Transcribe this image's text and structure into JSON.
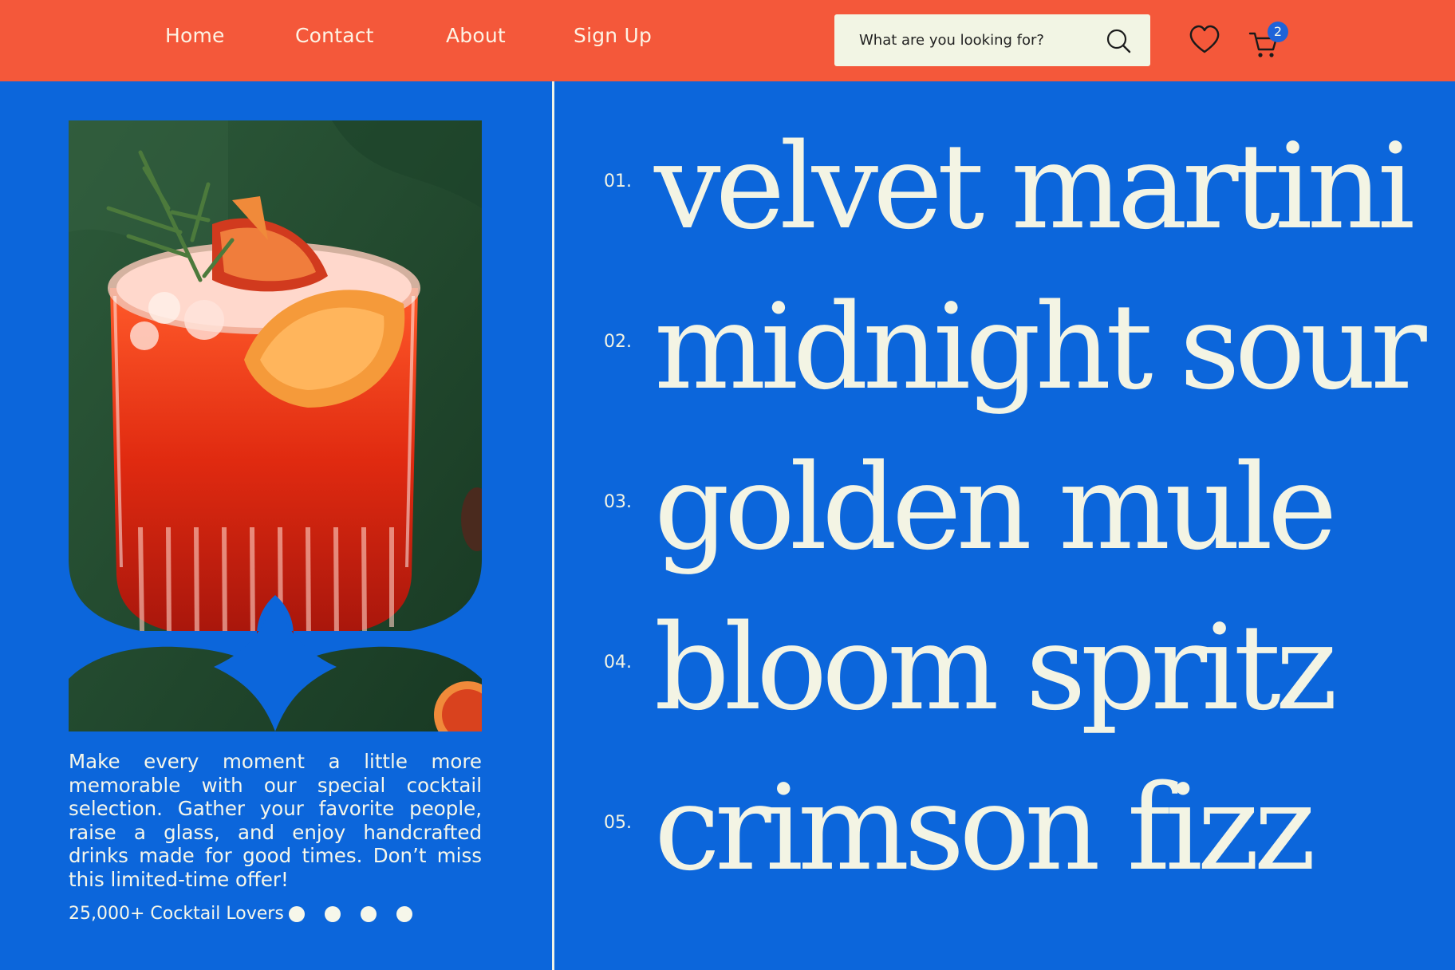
{
  "nav": {
    "links": [
      "Home",
      "Contact",
      "About",
      "Sign Up"
    ]
  },
  "search": {
    "placeholder": "What are you looking for?",
    "icon": "search-icon"
  },
  "header_icons": {
    "wishlist": "heart-icon",
    "cart": "cart-icon",
    "cart_count": "2"
  },
  "promo": {
    "image": "cocktail-photo",
    "description": "Make every moment a little more memorable with our special cocktail selection. Gather your favorite people, raise a glass, and enjoy handcrafted drinks made for good times. Don’t miss this limited-time offer!",
    "lovers": "25,000+ Cocktail Lovers",
    "dots_count": 4
  },
  "menu": {
    "items": [
      {
        "number": "01.",
        "name": "velvet martini"
      },
      {
        "number": "02.",
        "name": "midnight sour"
      },
      {
        "number": "03.",
        "name": "golden mule"
      },
      {
        "number": "04.",
        "name": "bloom spritz"
      },
      {
        "number": "05.",
        "name": "crimson fizz"
      }
    ]
  },
  "colors": {
    "nav_bg": "#f4583a",
    "page_bg": "#0c66db",
    "text": "#f3f4e4",
    "search_bg": "#f2f5e4"
  }
}
